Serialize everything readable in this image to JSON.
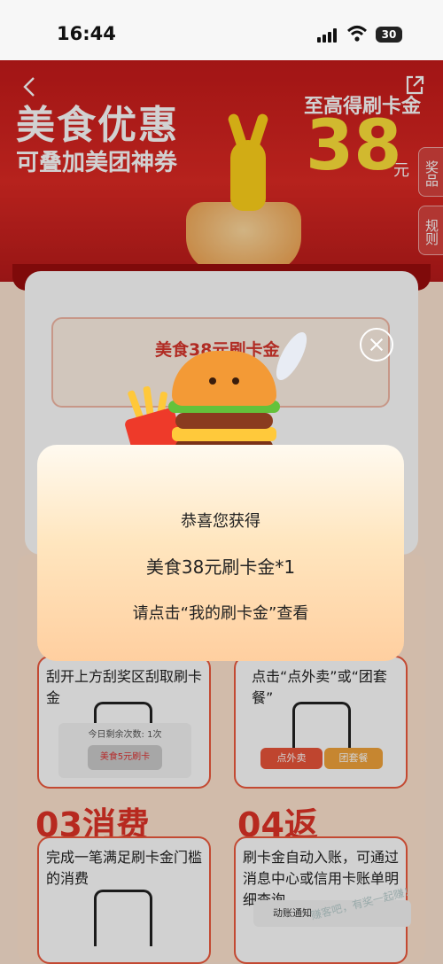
{
  "status_bar": {
    "time": "16:44",
    "battery": "30"
  },
  "header": {
    "title": "美食优惠",
    "subtitle": "可叠加美团神券",
    "max_label": "至高得刷卡金",
    "amount": "38",
    "unit": "元",
    "side_tabs": [
      "奖品",
      "规则"
    ]
  },
  "scratch_card": {
    "label": "美食38元刷卡金"
  },
  "steps": {
    "step1_text": "刮开上方刮奖区刮取刷卡金",
    "step1_mini": {
      "count": "今日剩余次数: 1次",
      "prize": "美食5元刷卡"
    },
    "step2_text": "点击“点外卖”或“团套餐”",
    "step2_buttons": [
      "点外卖",
      "团套餐"
    ],
    "step3_head": "03消费",
    "step3_text": "完成一笔满足刷卡金门槛的消费",
    "step4_head": "04返",
    "step4_text": "刷卡金自动入账，可通过消息中心或信用卡账单明细查询",
    "notice": "动账通知"
  },
  "modal": {
    "line1": "恭喜您获得",
    "line2": "美食38元刷卡金*1",
    "line3": "请点击“我的刷卡金”查看"
  },
  "watermark": "赚客吧，有奖一起赚！",
  "colors": {
    "brand_red": "#d8261f",
    "amount_yellow": "#ffe23a"
  }
}
